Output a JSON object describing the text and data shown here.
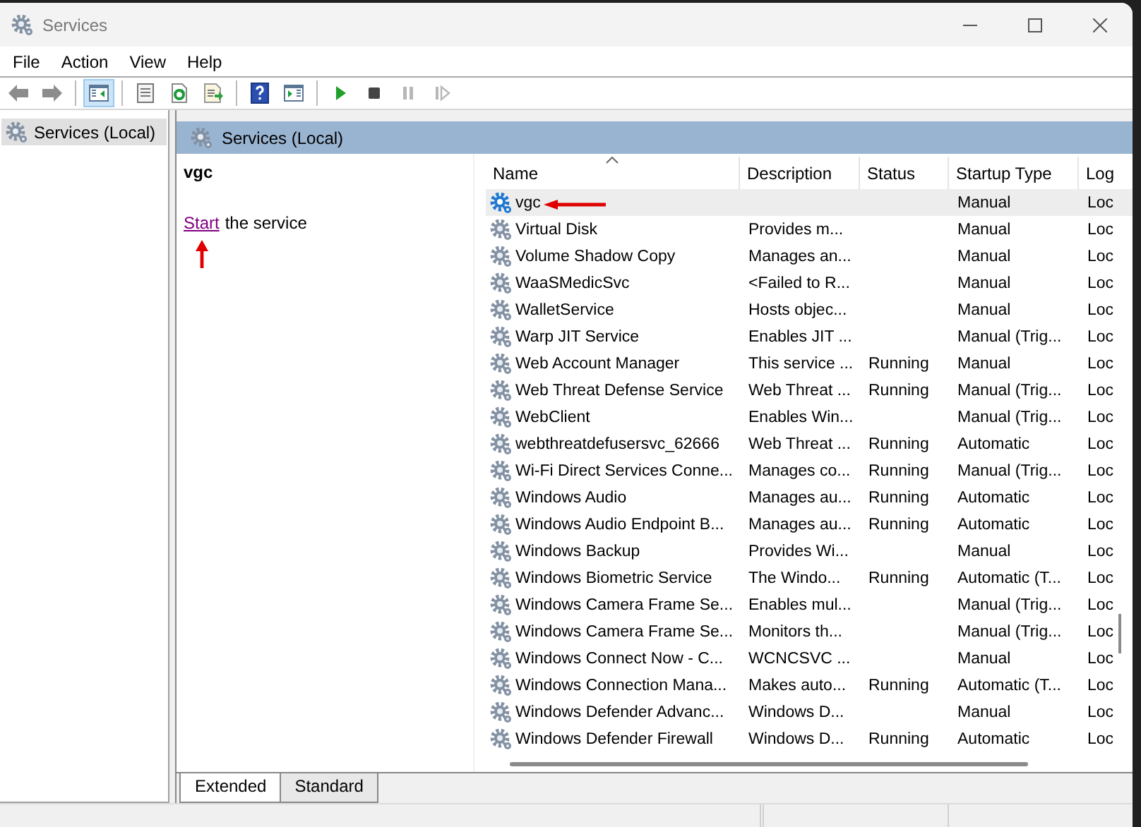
{
  "window": {
    "title": "Services"
  },
  "menu": [
    "File",
    "Action",
    "View",
    "Help"
  ],
  "toolbar": [
    {
      "kind": "back",
      "pressed": false,
      "disabled": false
    },
    {
      "kind": "forward",
      "pressed": false,
      "disabled": false
    },
    {
      "kind": "tree",
      "pressed": true,
      "disabled": false
    },
    {
      "kind": "properties",
      "pressed": false,
      "disabled": false
    },
    {
      "kind": "refresh",
      "pressed": false,
      "disabled": false
    },
    {
      "kind": "export",
      "pressed": false,
      "disabled": false
    },
    {
      "kind": "help",
      "pressed": false,
      "disabled": false
    },
    {
      "kind": "actionpane",
      "pressed": false,
      "disabled": false
    },
    {
      "kind": "play",
      "pressed": false,
      "disabled": false
    },
    {
      "kind": "stop",
      "pressed": false,
      "disabled": false
    },
    {
      "kind": "pause",
      "pressed": false,
      "disabled": true
    },
    {
      "kind": "resume",
      "pressed": false,
      "disabled": true
    }
  ],
  "tree": {
    "items": [
      {
        "label": "Services (Local)",
        "selected": true
      }
    ]
  },
  "panel": {
    "title": "Services (Local)",
    "service_name": "vgc",
    "action": {
      "link": "Start",
      "text": "the service",
      "marked": true
    }
  },
  "table": {
    "columns": [
      {
        "label": "Name",
        "sorted": true
      },
      {
        "label": "Description",
        "sorted": false
      },
      {
        "label": "Status",
        "sorted": false
      },
      {
        "label": "Startup Type",
        "sorted": false
      },
      {
        "label": "Log",
        "sorted": false
      }
    ],
    "rows": [
      {
        "name": "vgc",
        "startup_type": "Manual",
        "log": "Loc",
        "selected": true,
        "marked": true
      },
      {
        "name": "Virtual Disk",
        "description": "Provides m...",
        "startup_type": "Manual",
        "log": "Loc",
        "selected": false,
        "marked": false
      },
      {
        "name": "Volume Shadow Copy",
        "description": "Manages an...",
        "startup_type": "Manual",
        "log": "Loc",
        "selected": false,
        "marked": false
      },
      {
        "name": "WaaSMedicSvc",
        "description": "<Failed to R...",
        "startup_type": "Manual",
        "log": "Loc",
        "selected": false,
        "marked": false
      },
      {
        "name": "WalletService",
        "description": "Hosts objec...",
        "startup_type": "Manual",
        "log": "Loc",
        "selected": false,
        "marked": false
      },
      {
        "name": "Warp JIT Service",
        "description": "Enables JIT ...",
        "startup_type": "Manual (Trig...",
        "log": "Loc",
        "selected": false,
        "marked": false
      },
      {
        "name": "Web Account Manager",
        "description": "This service ...",
        "status": "Running",
        "startup_type": "Manual",
        "log": "Loc",
        "selected": false,
        "marked": false
      },
      {
        "name": "Web Threat Defense Service",
        "description": "Web Threat ...",
        "status": "Running",
        "startup_type": "Manual (Trig...",
        "log": "Loc",
        "selected": false,
        "marked": false
      },
      {
        "name": "WebClient",
        "description": "Enables Win...",
        "startup_type": "Manual (Trig...",
        "log": "Loc",
        "selected": false,
        "marked": false
      },
      {
        "name": "webthreatdefusersvc_62666",
        "description": "Web Threat ...",
        "status": "Running",
        "startup_type": "Automatic",
        "log": "Loc",
        "selected": false,
        "marked": false
      },
      {
        "name": "Wi-Fi Direct Services Conne...",
        "description": "Manages co...",
        "status": "Running",
        "startup_type": "Manual (Trig...",
        "log": "Loc",
        "selected": false,
        "marked": false
      },
      {
        "name": "Windows Audio",
        "description": "Manages au...",
        "status": "Running",
        "startup_type": "Automatic",
        "log": "Loc",
        "selected": false,
        "marked": false
      },
      {
        "name": "Windows Audio Endpoint B...",
        "description": "Manages au...",
        "status": "Running",
        "startup_type": "Automatic",
        "log": "Loc",
        "selected": false,
        "marked": false
      },
      {
        "name": "Windows Backup",
        "description": "Provides Wi...",
        "startup_type": "Manual",
        "log": "Loc",
        "selected": false,
        "marked": false
      },
      {
        "name": "Windows Biometric Service",
        "description": "The Windo...",
        "status": "Running",
        "startup_type": "Automatic (T...",
        "log": "Loc",
        "selected": false,
        "marked": false
      },
      {
        "name": "Windows Camera Frame Se...",
        "description": "Enables mul...",
        "startup_type": "Manual (Trig...",
        "log": "Loc",
        "selected": false,
        "marked": false
      },
      {
        "name": "Windows Camera Frame Se...",
        "description": "Monitors th...",
        "startup_type": "Manual (Trig...",
        "log": "Loc",
        "selected": false,
        "marked": false
      },
      {
        "name": "Windows Connect Now - C...",
        "description": "WCNCSVC ...",
        "startup_type": "Manual",
        "log": "Loc",
        "selected": false,
        "marked": false
      },
      {
        "name": "Windows Connection Mana...",
        "description": "Makes auto...",
        "status": "Running",
        "startup_type": "Automatic (T...",
        "log": "Loc",
        "selected": false,
        "marked": false
      },
      {
        "name": "Windows Defender Advanc...",
        "description": "Windows D...",
        "startup_type": "Manual",
        "log": "Loc",
        "selected": false,
        "marked": false
      },
      {
        "name": "Windows Defender Firewall",
        "description": "Windows D...",
        "status": "Running",
        "startup_type": "Automatic",
        "log": "Loc",
        "selected": false,
        "marked": false
      }
    ]
  },
  "view_tabs": [
    {
      "label": "Extended",
      "selected": true
    },
    {
      "label": "Standard",
      "selected": false
    }
  ]
}
